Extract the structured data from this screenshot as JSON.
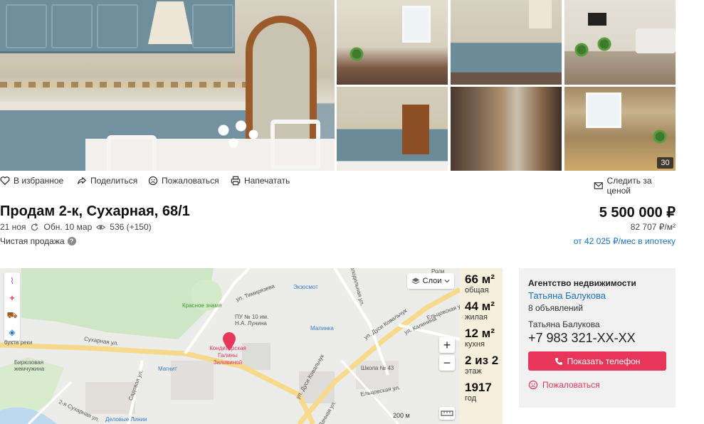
{
  "gallery": {
    "photo_count": "30"
  },
  "actions": {
    "favorite": "В избранное",
    "share": "Поделиться",
    "report": "Пожаловаться",
    "print": "Напечатать",
    "track_price": "Следить за ценой"
  },
  "listing": {
    "title": "Продам 2-к, Сухарная, 68/1",
    "date": "21 ноя",
    "updated": "Обн. 10 мар",
    "views": "536 (+150)",
    "sale_type": "Чистая продажа",
    "price": "5 500 000 ₽",
    "price_per_m2": "82 707 ₽/м²",
    "mortgage": "от 42 025 ₽/мес в ипотеку"
  },
  "map": {
    "layers": "Слои",
    "scale": "200 м",
    "labels": {
      "tool": "Кондитерская Галины Заливиной",
      "pu": "ПУ № 10 им. Н.А. Лунина",
      "ekso": "Экзосмот",
      "red": "Красное знамя",
      "malinka": "Малинка",
      "sukh": "Сухарная ул.",
      "timir": "ул. Тимирязева",
      "koval": "ул. Дуси Ковальчук",
      "school": "Школа № 43",
      "magnit": "Магнит",
      "biryuz": "Бирюзовая жемчужина",
      "delovye": "Деловые Линии",
      "kholod": "Холодильная ул.",
      "kalinina": "ул. Калинина",
      "eltsov": "Ельцовская ул.",
      "sadovaya": "Садовая ул.",
      "dach": "Дачная ул.",
      "river": "бухта реки",
      "rolan": "Роли",
      "second": "2-я Сухарная ул."
    }
  },
  "specs": [
    {
      "value": "66 м²",
      "label": "общая"
    },
    {
      "value": "44 м²",
      "label": "жилая"
    },
    {
      "value": "12 м²",
      "label": "кухня"
    },
    {
      "value": "2 из 2",
      "label": "этаж"
    },
    {
      "value": "1917",
      "label": "год"
    }
  ],
  "agent": {
    "heading": "Агентство недвижимости",
    "name": "Татьяна Балукова",
    "ads": "8 объявлений",
    "person": "Татьяна Балукова",
    "phone": "+7 983 321-XX-XX",
    "show_phone": "Показать телефон",
    "complain": "Пожаловаться"
  }
}
